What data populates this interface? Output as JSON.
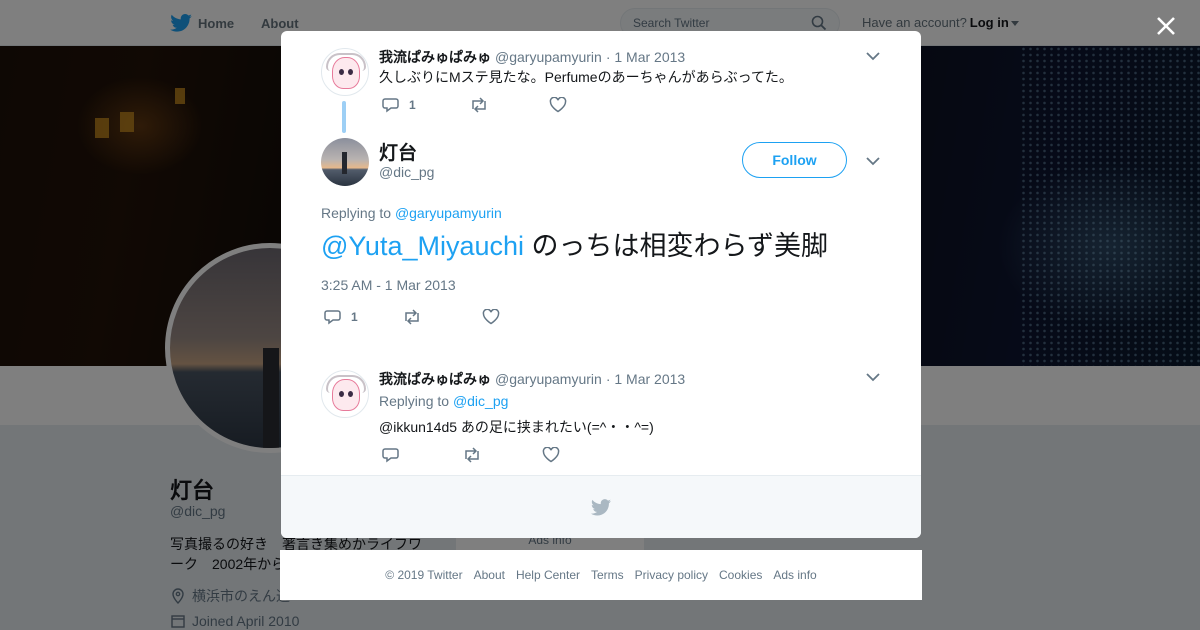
{
  "topbar": {
    "home_label": "Home",
    "about_label": "About",
    "search_placeholder": "Search Twitter",
    "have_account": "Have an account?",
    "login_label": "Log in"
  },
  "profile": {
    "name": "灯台",
    "handle": "@dic_pg",
    "bio": "写真撮るの好き　著言き集めかライフワーク　2002年から",
    "location": "横浜市のえん辺",
    "joined": "Joined April 2010"
  },
  "modal": {
    "tweet1": {
      "name": "我流ぱみゅぱみゅ",
      "handle": "@garyupamyurin",
      "date": "· 1 Mar 2013",
      "text": "久しぶりにMステ見たな。Perfumeのあーちゃんがあらぶってた。",
      "reply_count": "1"
    },
    "main_tweet": {
      "name": "灯台",
      "handle": "@dic_pg",
      "follow_label": "Follow",
      "replying_to_label": "Replying to",
      "replying_to_handle": "@garyupamyurin",
      "mention": "@Yuta_Miyauchi",
      "text": " のっちは相変わらず美脚",
      "timestamp": "3:25 AM - 1 Mar 2013",
      "reply_count": "1"
    },
    "tweet3": {
      "name": "我流ぱみゅぱみゅ",
      "handle": "@garyupamyurin",
      "date": "· 1 Mar 2013",
      "replying_to_label": "Replying to",
      "replying_to_handle": "@dic_pg",
      "text": "@ikkun14d5 あの足に挟まれたい(=^・・^=)"
    }
  },
  "ads_peek": "Ads info",
  "footer": {
    "copyright": "© 2019 Twitter",
    "links": [
      "About",
      "Help Center",
      "Terms",
      "Privacy policy",
      "Cookies",
      "Ads info"
    ]
  },
  "colors": {
    "accent": "#1da1f2",
    "muted": "#657786",
    "thread_line": "#9dcff5"
  }
}
